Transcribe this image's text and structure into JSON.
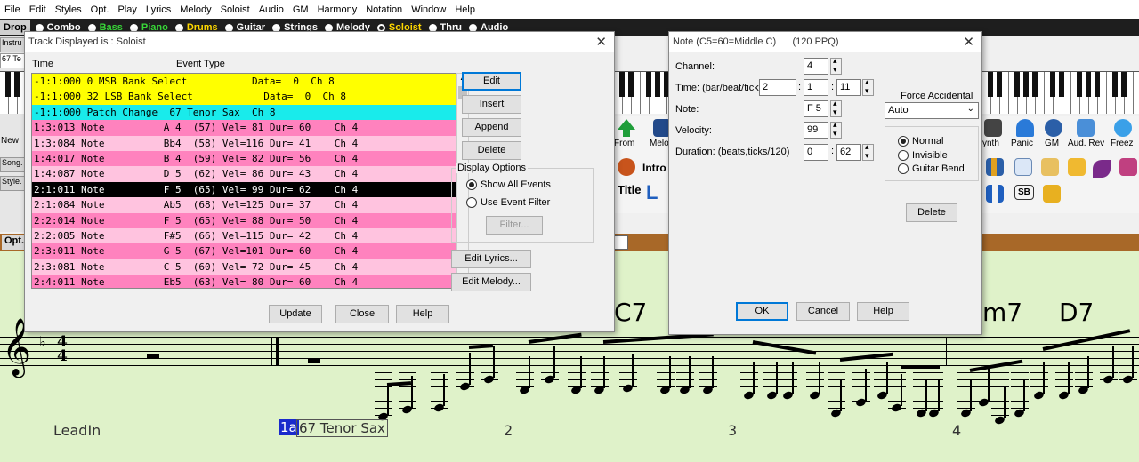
{
  "menu": [
    "File",
    "Edit",
    "Styles",
    "Opt.",
    "Play",
    "Lyrics",
    "Melody",
    "Soloist",
    "Audio",
    "GM",
    "Harmony",
    "Notation",
    "Window",
    "Help"
  ],
  "trackbar": {
    "drop_label": "Drop",
    "tracks": [
      {
        "label": "Combo",
        "color": "#ffffff",
        "selected": false
      },
      {
        "label": "Bass",
        "color": "#39d839",
        "selected": false
      },
      {
        "label": "Piano",
        "color": "#39d839",
        "selected": false
      },
      {
        "label": "Drums",
        "color": "#ffd800",
        "selected": false
      },
      {
        "label": "Guitar",
        "color": "#ffffff",
        "selected": false
      },
      {
        "label": "Strings",
        "color": "#ffffff",
        "selected": false
      },
      {
        "label": "Melody",
        "color": "#ffffff",
        "selected": false
      },
      {
        "label": "Soloist",
        "color": "#ffd800",
        "selected": true
      },
      {
        "label": "Thru",
        "color": "#ffffff",
        "selected": false
      },
      {
        "label": "Audio",
        "color": "#ffffff",
        "selected": false
      }
    ]
  },
  "left_buttons": [
    "Instru",
    "67 Te",
    "New",
    "Song.",
    "Style."
  ],
  "right_toolbar": {
    "labels": [
      "ynth",
      "Panic",
      "GM",
      "Aud. Rev",
      "Freez"
    ],
    "intro": "Intro",
    "title": "Title",
    "from": "From",
    "melo": "Melo",
    "l": "L",
    "sb": "SB"
  },
  "brownbar": {
    "opt_label": "Opt."
  },
  "track_dialog": {
    "title": "Track Displayed is : Soloist",
    "col_time": "Time",
    "col_event": "Event Type",
    "events": [
      {
        "text": "-1:1:000 0 MSB Bank Select           Data=  0  Ch 8",
        "bg": "#ffff00",
        "fg": "#000000"
      },
      {
        "text": "-1:1:000 32 LSB Bank Select            Data=  0  Ch 8",
        "bg": "#ffff00",
        "fg": "#000000"
      },
      {
        "text": "-1:1:000 Patch Change  67 Tenor Sax  Ch 8",
        "bg": "#19ebeb",
        "fg": "#000000"
      },
      {
        "text": "1:3:013 Note          A 4  (57) Vel= 81 Dur= 60    Ch 4",
        "bg": "#ff82be",
        "fg": "#000000"
      },
      {
        "text": "1:3:084 Note          Bb4  (58) Vel=116 Dur= 41    Ch 4",
        "bg": "#ffc3df",
        "fg": "#000000"
      },
      {
        "text": "1:4:017 Note          B 4  (59) Vel= 82 Dur= 56    Ch 4",
        "bg": "#ff82be",
        "fg": "#000000"
      },
      {
        "text": "1:4:087 Note          D 5  (62) Vel= 86 Dur= 43    Ch 4",
        "bg": "#ffc3df",
        "fg": "#000000"
      },
      {
        "text": "2:1:011 Note          F 5  (65) Vel= 99 Dur= 62    Ch 4",
        "bg": "#000000",
        "fg": "#ffffff"
      },
      {
        "text": "2:1:084 Note          Ab5  (68) Vel=125 Dur= 37    Ch 4",
        "bg": "#ffc3df",
        "fg": "#000000"
      },
      {
        "text": "2:2:014 Note          F 5  (65) Vel= 88 Dur= 50    Ch 4",
        "bg": "#ff82be",
        "fg": "#000000"
      },
      {
        "text": "2:2:085 Note          F#5  (66) Vel=115 Dur= 42    Ch 4",
        "bg": "#ffc3df",
        "fg": "#000000"
      },
      {
        "text": "2:3:011 Note          G 5  (67) Vel=101 Dur= 60    Ch 4",
        "bg": "#ff82be",
        "fg": "#000000"
      },
      {
        "text": "2:3:081 Note          C 5  (60) Vel= 72 Dur= 45    Ch 4",
        "bg": "#ffc3df",
        "fg": "#000000"
      },
      {
        "text": "2:4:011 Note          Eb5  (63) Vel= 80 Dur= 60    Ch 4",
        "bg": "#ff82be",
        "fg": "#000000"
      }
    ],
    "buttons": {
      "edit": "Edit",
      "insert": "Insert",
      "append": "Append",
      "delete": "Delete",
      "filter": "Filter...",
      "edit_lyrics": "Edit Lyrics...",
      "edit_melody": "Edit Melody...",
      "update": "Update",
      "close": "Close",
      "help": "Help"
    },
    "display_options": {
      "label": "Display Options",
      "show_all": "Show All Events",
      "use_filter": "Use Event Filter"
    }
  },
  "note_dialog": {
    "title": "Note (C5=60=Middle C)",
    "ppq": "(120 PPQ)",
    "channel_label": "Channel:",
    "channel_value": "4",
    "time_label": "Time: (bar/beat/tick)",
    "time_bar": "2",
    "time_beat": "1",
    "time_tick": "11",
    "note_label": "Note:",
    "note_value": "F 5",
    "velocity_label": "Velocity:",
    "velocity_value": "99",
    "duration_label": "Duration: (beats,ticks/120)",
    "duration_beats": "0",
    "duration_ticks": "62",
    "force_accidental_label": "Force Accidental",
    "force_accidental_value": "Auto",
    "display_type": {
      "normal": "Normal",
      "invisible": "Invisible",
      "guitar_bend": "Guitar Bend"
    },
    "buttons": {
      "delete": "Delete",
      "ok": "OK",
      "cancel": "Cancel",
      "help": "Help"
    }
  },
  "notation": {
    "chords": [
      "C7",
      "m7",
      "D7"
    ],
    "time_signature": {
      "top": "4",
      "bottom": "4"
    },
    "leadin": "LeadIn",
    "patch_marker_num": "1a",
    "patch_marker": "67 Tenor Sax",
    "measure_numbers": [
      "2",
      "3",
      "4"
    ]
  }
}
